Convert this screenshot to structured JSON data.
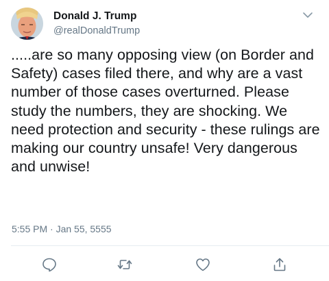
{
  "author": {
    "display_name": "Donald J. Trump",
    "handle": "@realDonaldTrump",
    "avatar_icon": "profile-photo"
  },
  "tweet": {
    "text": ".....are so many opposing view (on Border and Safety) cases filed there, and why are a vast number of those cases overturned. Please study the numbers, they are shocking. We need protection and security - these rulings are making our country unsafe! Very dangerous and unwise!",
    "timestamp": "5:55 PM · Jan 55, 5555"
  },
  "actions": [
    {
      "name": "reply",
      "icon": "speech-bubble-icon"
    },
    {
      "name": "retweet",
      "icon": "retweet-arrows-icon"
    },
    {
      "name": "like",
      "icon": "heart-icon"
    },
    {
      "name": "share",
      "icon": "share-upload-icon"
    }
  ],
  "colors": {
    "text": "#14171a",
    "secondary": "#657786",
    "divider": "#e6ecf0"
  }
}
